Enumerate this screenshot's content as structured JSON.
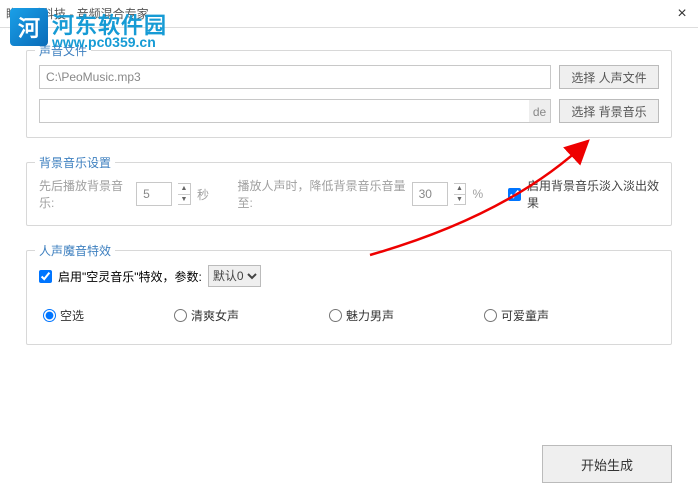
{
  "window": {
    "title": "瞻天瞰科技 - 音频混合专家",
    "close_icon": "×"
  },
  "watermark": {
    "logo_letter": "河",
    "site_name": "河东软件园",
    "url": "www.pc0359.cn"
  },
  "voice_group": {
    "title": "声音文件",
    "voice_path": "C:\\PeoMusic.mp3",
    "select_voice_btn": "选择 人声文件",
    "bgm_path": "",
    "de_label": "de",
    "select_bgm_btn": "选择 背景音乐"
  },
  "bg_settings": {
    "title": "背景音乐设置",
    "pre_label": "先后播放背景音乐:",
    "pre_seconds": "5",
    "seconds_unit": "秒",
    "reduce_label": "播放人声时，降低背景音乐音量至:",
    "reduce_value": "30",
    "percent_unit": "%",
    "fade_checked": true,
    "fade_label": "启用背景音乐淡入淡出效果"
  },
  "effects": {
    "title": "人声魔音特效",
    "enable_checked": true,
    "enable_label": "启用\"空灵音乐\"特效，参数:",
    "param_selected": "默认0",
    "radios": {
      "r1": "空选",
      "r2": "清爽女声",
      "r3": "魅力男声",
      "r4": "可爱童声"
    },
    "radio_selected": "r1"
  },
  "actions": {
    "generate": "开始生成"
  }
}
